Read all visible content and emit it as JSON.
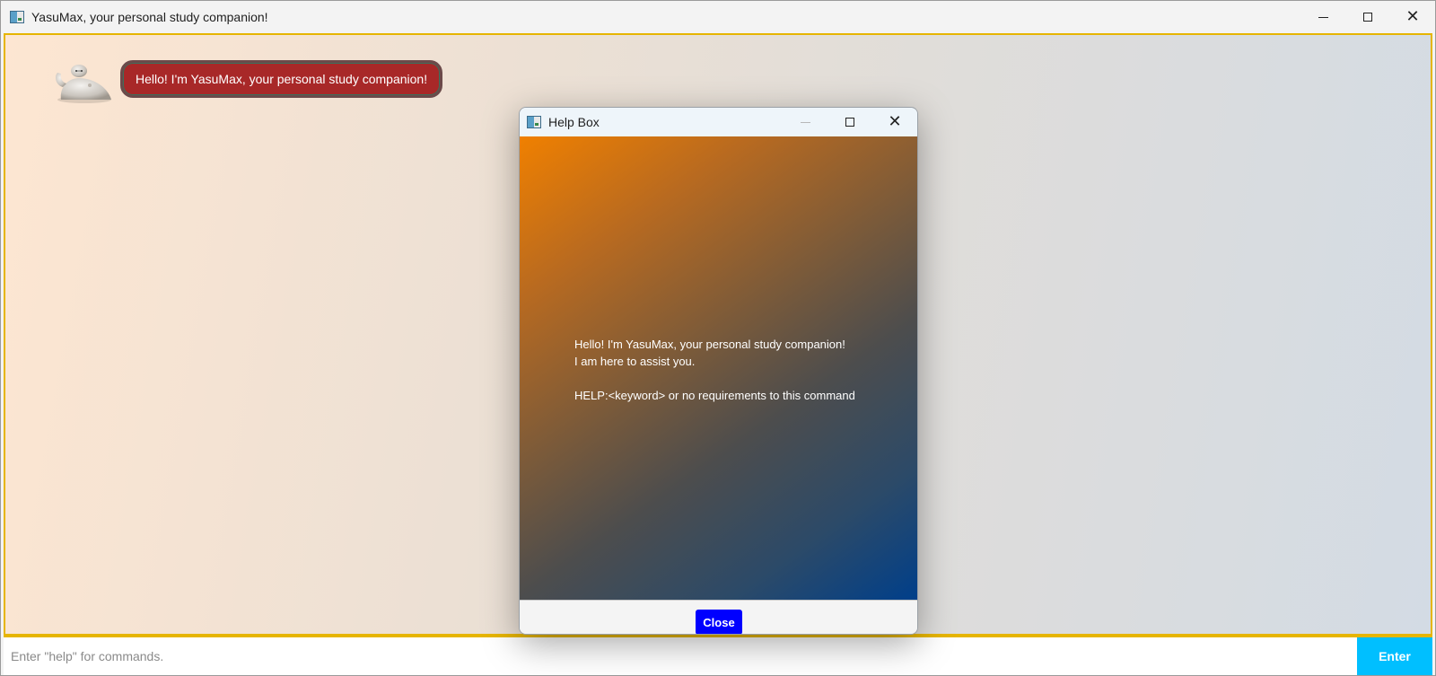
{
  "window": {
    "title": "YasuMax, your personal study companion!",
    "controls": {
      "minimize_icon": "minimize-icon",
      "maximize_icon": "maximize-icon",
      "close_icon": "close-icon",
      "close_glyph": "✕"
    }
  },
  "chat": {
    "messages": [
      {
        "sender": "bot",
        "text": "Hello! I'm YasuMax, your personal study companion!"
      }
    ],
    "colors": {
      "bubble_bg": "#a82828",
      "border_accent": "#e6b500"
    }
  },
  "input_bar": {
    "placeholder": "Enter \"help\" for commands.",
    "value": "",
    "enter_label": "Enter",
    "enter_color": "#00bfff"
  },
  "help_dialog": {
    "title": "Help Box",
    "close_glyph": "✕",
    "lines": [
      "Hello! I'm YasuMax, your personal study companion!",
      "I am here to assist you.",
      "",
      "HELP:<keyword> or no requirements to this command"
    ],
    "close_label": "Close",
    "close_color": "#0000ff"
  }
}
